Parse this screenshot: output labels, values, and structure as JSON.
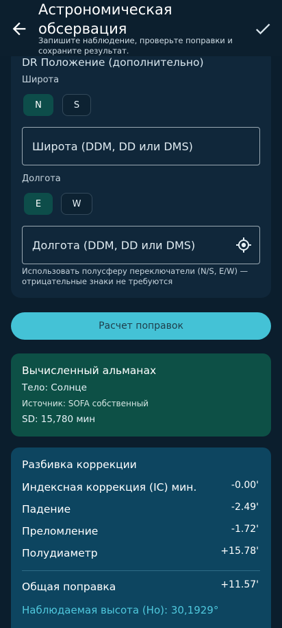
{
  "appbar": {
    "title": "Астрономическая обсервация",
    "subtitle": "Запишите наблюдение, проверьте поправки и сохраните результат."
  },
  "position": {
    "section_title": "DR Положение (дополнительно)",
    "latitude_label": "Широта",
    "lat_hemispheres": [
      "N",
      "S"
    ],
    "lat_selected": "N",
    "latitude_placeholder": "Широта (DDM, DD или DMS)",
    "longitude_label": "Долгота",
    "lon_hemispheres": [
      "E",
      "W"
    ],
    "lon_selected": "E",
    "longitude_placeholder": "Долгота (DDM, DD или DMS)",
    "hint": "Использовать полусферу переключатели (N/S, E/W) — отрицательные знаки не требуются"
  },
  "actions": {
    "calculate_label": "Расчет поправок"
  },
  "almanac": {
    "title": "Вычисленный альманах",
    "body": "Тело: Солнце",
    "source": "Источник: SOFA собственный",
    "sd": "SD: 15,780 мин"
  },
  "corrections": {
    "title": "Разбивка коррекции",
    "rows": [
      {
        "label": "Индексная коррекция (IC) мин.",
        "value": "-0.00'"
      },
      {
        "label": "Падение",
        "value": "-2.49'"
      },
      {
        "label": "Преломление",
        "value": "-1.72'"
      },
      {
        "label": "Полудиаметр",
        "value": "+15.78'"
      }
    ],
    "total_label": "Общая поправка",
    "total_value": "+11.57'",
    "observed_altitude": "Наблюдаемая высота (Ho): 30,1929°"
  },
  "colors": {
    "accent": "#44c2d6",
    "selected_chip": "#0d4d4a",
    "almanac_card": "#0d5046",
    "corrections_card": "#0d4560"
  },
  "icons": {
    "back": "arrow-left-icon",
    "confirm": "check-icon",
    "gps": "crosshair-icon"
  }
}
